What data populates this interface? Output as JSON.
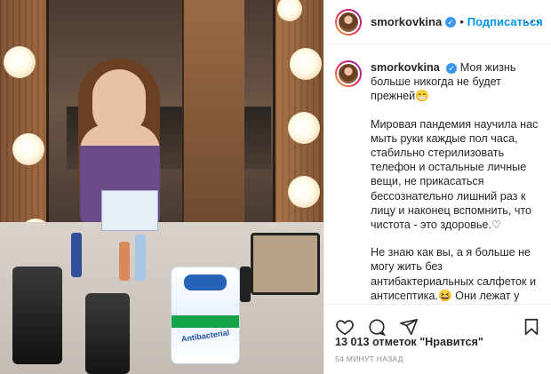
{
  "post": {
    "username": "smorkovkina",
    "verified_mark": "✓",
    "follow_label": "Подписаться",
    "separator": "•",
    "more_label": "···"
  },
  "caption": {
    "username": "smorkovkina",
    "verified_mark": "✓",
    "paragraphs": [
      "Моя жизнь больше никогда не будет прежней😁",
      "Мировая пандемия научила нас мыть руки каждые пол часа, стабильно стерилизовать телефон и остальные личные вещи, не прикасаться бессознательно лишний раз к лицу и наконец вспомнить, что чистота - это здоровье.♡",
      "Не знаю как вы, а я больше не могу жить без антибактериальных салфеток и антисептика.😆 Они лежат у меня в каждой сумке и рюкзаке, во всех куртках) ну и конечно же в каждой паре штанов всегда спрятана минимум одна маска, уверена вам это знакомо 😁"
    ]
  },
  "actions": {
    "like_icon": "heart-icon",
    "comment_icon": "comment-icon",
    "share_icon": "share-icon",
    "save_icon": "bookmark-icon"
  },
  "likes_text": "13 013 отметок \"Нравится\"",
  "timestamp": "54 МИНУТ НАЗАД",
  "photo": {
    "wipes_label": "Antibacterial"
  },
  "colors": {
    "accent": "#0095f6",
    "verified": "#3897f0",
    "text": "#262626",
    "muted": "#8e8e8e"
  }
}
